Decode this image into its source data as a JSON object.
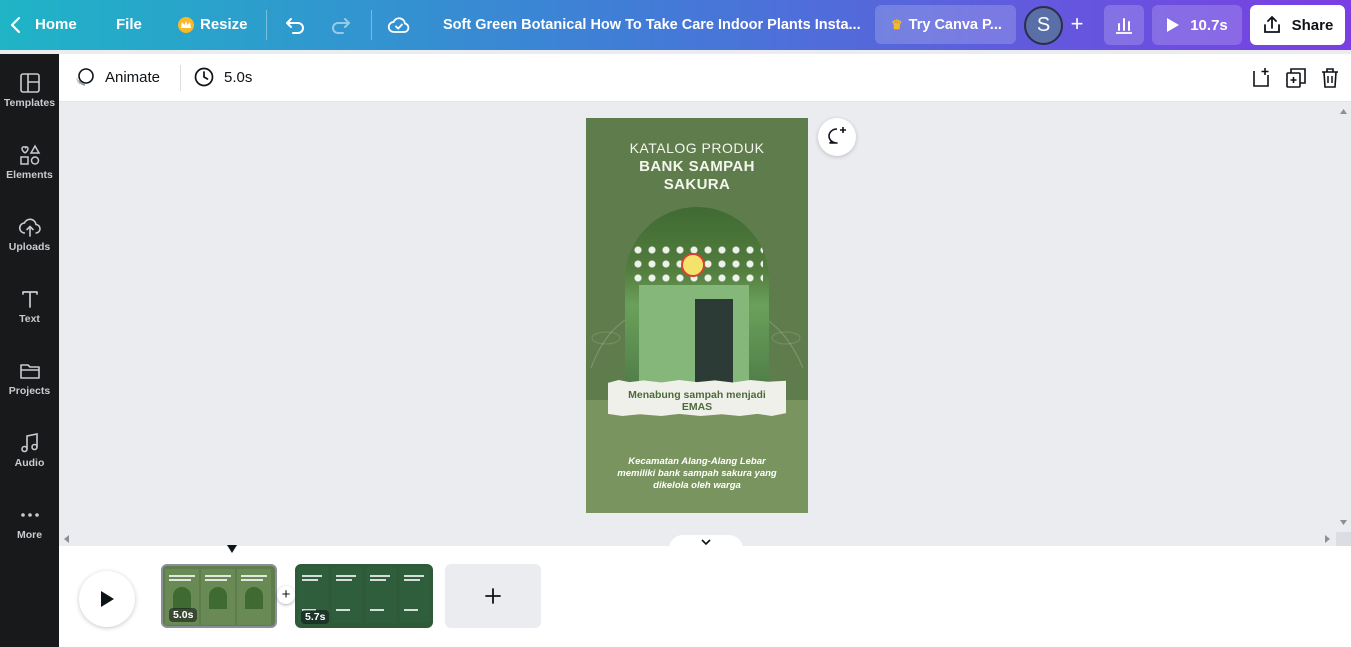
{
  "topbar": {
    "home_label": "Home",
    "file_label": "File",
    "resize_label": "Resize",
    "doc_title": "Soft Green Botanical How To Take Care Indoor Plants Insta...",
    "try_label": "Try Canva P...",
    "avatar_initial": "S",
    "play_duration": "10.7s",
    "share_label": "Share"
  },
  "sidebar": {
    "items": [
      {
        "label": "Templates",
        "icon": "templates-icon"
      },
      {
        "label": "Elements",
        "icon": "elements-icon"
      },
      {
        "label": "Uploads",
        "icon": "uploads-icon"
      },
      {
        "label": "Text",
        "icon": "text-icon"
      },
      {
        "label": "Projects",
        "icon": "projects-icon"
      },
      {
        "label": "Audio",
        "icon": "audio-icon"
      },
      {
        "label": "More",
        "icon": "more-icon"
      }
    ]
  },
  "toolbar": {
    "animate_label": "Animate",
    "duration": "5.0s"
  },
  "design": {
    "title_line1": "KATALOG PRODUK",
    "title_line2": "BANK SAMPAH",
    "title_line3": "SAKURA",
    "tagline_line1": "Menabung sampah menjadi",
    "tagline_line2": "EMAS",
    "desc_line1": "Kecamatan Alang-Alang Lebar",
    "desc_line2": "memiliki bank sampah sakura yang",
    "desc_line3": "dikelola oleh warga",
    "bg_color": "#5f7c4c",
    "bottom_color": "#7a945f"
  },
  "timeline": {
    "clips": [
      {
        "duration": "5.0s"
      },
      {
        "duration": "5.7s"
      }
    ]
  },
  "colors": {
    "accent_gradient_start": "#1fb4c6",
    "accent_gradient_end": "#7b3ee3",
    "sidebar_bg": "#18191b"
  }
}
